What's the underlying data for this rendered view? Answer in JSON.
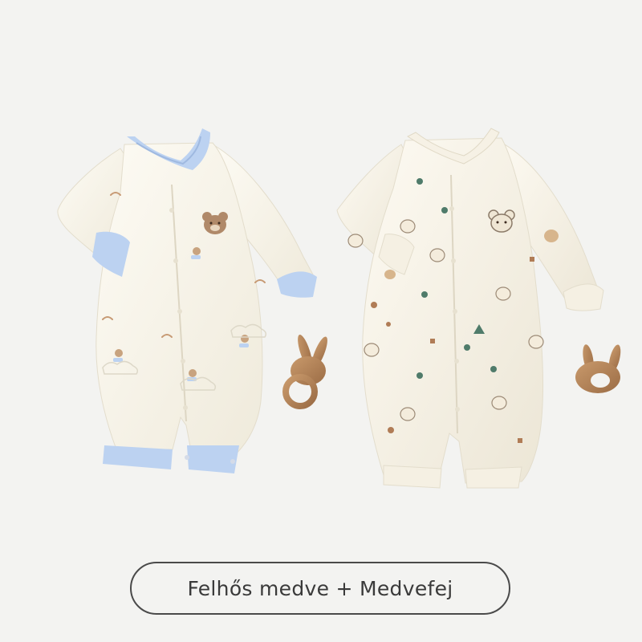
{
  "caption": {
    "label": "Felhős medve + Medvefej"
  },
  "colors": {
    "background": "#f3f3f1",
    "onesie_fabric": "#fbf8ef",
    "blue_trim": "#b9cff0",
    "wood_toy": "#b8895f"
  },
  "products": [
    {
      "name": "cloud-bear-onesie",
      "trim": "blue"
    },
    {
      "name": "bear-head-onesie",
      "trim": "cream"
    }
  ]
}
